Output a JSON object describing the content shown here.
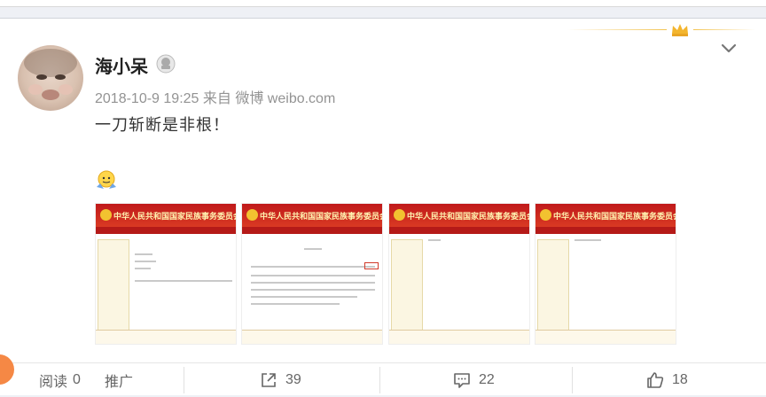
{
  "post": {
    "username": "海小呆",
    "timestamp": "2018-10-9 19:25",
    "source_prefix": "来自",
    "source": "微博 weibo.com",
    "text": "一刀斩断是非根！",
    "emoji": "shrug-emoji",
    "badge_icon": "vip-badge-icon",
    "menu_icon": "chevron-down-icon"
  },
  "thumbnails": [
    {
      "header_title": "中华人民共和国国家民族事务委员会"
    },
    {
      "header_title": "中华人民共和国国家民族事务委员会"
    },
    {
      "header_title": "中华人民共和国国家民族事务委员会"
    },
    {
      "header_title": "中华人民共和国国家民族事务委员会"
    }
  ],
  "actions": {
    "read_label": "阅读",
    "read_count": "0",
    "promote_label": "推广",
    "share_count": "39",
    "comment_count": "22",
    "like_count": "18"
  },
  "colors": {
    "accent": "#f58845",
    "header_red": "#c0191a",
    "gold": "#f3c451"
  }
}
